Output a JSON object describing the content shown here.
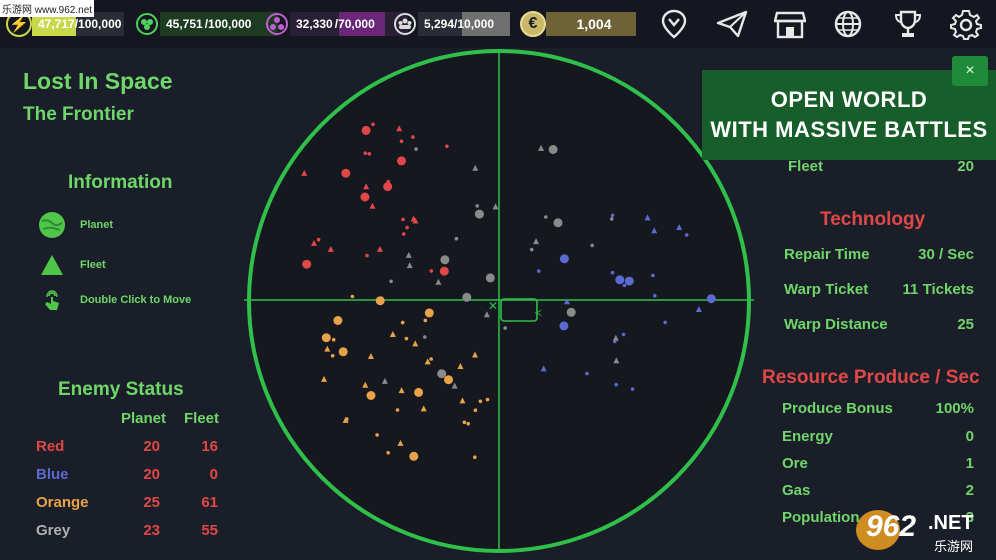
{
  "watermark": "乐游网 www.962.net",
  "resources": [
    {
      "name": "energy",
      "icon": "lightning-icon",
      "value": "47,717",
      "max": "/100,000",
      "color": "#c8d84a",
      "fill": 0.48
    },
    {
      "name": "ore",
      "icon": "ore-icon",
      "value": "45,751",
      "max": "/100,000",
      "color": "#2f8f3a",
      "fill": 0.46
    },
    {
      "name": "gas",
      "icon": "gas-icon",
      "value": "32,330",
      "max": "/70,000",
      "color": "#8a2f9a",
      "fill": 0.46
    },
    {
      "name": "population",
      "icon": "population-icon",
      "value": "5,294",
      "max": "/10,000",
      "color": "#8a8a8a",
      "fill": 0.53
    },
    {
      "name": "coins",
      "icon": "coin-icon",
      "value": "1,004",
      "max": "",
      "color": "#b7a55a",
      "fill": 1.0
    }
  ],
  "top_icons": [
    "location-icon",
    "paper-plane-icon",
    "shop-icon",
    "globe-icon",
    "trophy-icon",
    "gear-icon"
  ],
  "left": {
    "title": "Lost In Space",
    "subtitle": "The Frontier",
    "info_heading": "Information",
    "legend": [
      {
        "icon": "planet-icon",
        "label": "Planet"
      },
      {
        "icon": "fleet-icon",
        "label": "Fleet"
      },
      {
        "icon": "tap-icon",
        "label": "Double Click to Move"
      }
    ],
    "enemy_heading": "Enemy Status",
    "col_planet": "Planet",
    "col_fleet": "Fleet",
    "enemies": [
      {
        "name": "Red",
        "planet": "20",
        "fleet": "16",
        "color": "#e04848"
      },
      {
        "name": "Blue",
        "planet": "20",
        "fleet": "0",
        "color": "#5a6ad0"
      },
      {
        "name": "Orange",
        "planet": "25",
        "fleet": "61",
        "color": "#e8a24a"
      },
      {
        "name": "Grey",
        "planet": "23",
        "fleet": "55",
        "color": "#b0b0b0"
      }
    ]
  },
  "banner": {
    "line1": "OPEN WORLD",
    "line2": "WITH MASSIVE BATTLES",
    "close": "×"
  },
  "right": {
    "fleet_label": "Fleet",
    "fleet_value": "20",
    "tech_heading": "Technology",
    "tech": [
      {
        "label": "Repair Time",
        "value": "30 / Sec"
      },
      {
        "label": "Warp Ticket",
        "value": "11 Tickets"
      },
      {
        "label": "Warp Distance",
        "value": "25"
      }
    ],
    "res_heading": "Resource Produce / Sec",
    "produce": [
      {
        "label": "Produce Bonus",
        "value": "100%"
      },
      {
        "label": "Energy",
        "value": "0"
      },
      {
        "label": "Ore",
        "value": "1"
      },
      {
        "label": "Gas",
        "value": "2"
      },
      {
        "label": "Population",
        "value": "3"
      }
    ]
  },
  "logo": {
    "text": "962",
    "suffix": ".NET",
    "sub": "乐游网"
  },
  "colors": {
    "green": "#6fd66a",
    "red": "#e04848",
    "radar": "#2fbf4a"
  }
}
